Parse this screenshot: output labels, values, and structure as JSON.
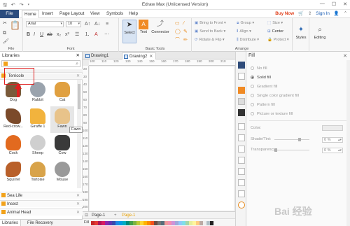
{
  "window": {
    "title": "Edraw Max (Unlicensed Version)",
    "controls": [
      "—",
      "☐",
      "✕"
    ]
  },
  "menu": {
    "file": "File",
    "items": [
      "Home",
      "Insert",
      "Page Layout",
      "View",
      "Symbols",
      "Help"
    ],
    "buy_now": "Buy Now",
    "sign_in": "Sign In"
  },
  "ribbon": {
    "font_name": "Arial",
    "font_size": "10",
    "group_file": "File",
    "group_font": "Font",
    "group_basic_tools": "Basic Tools",
    "group_arrange": "Arrange",
    "select": "Select",
    "text": "Text",
    "connector": "Connector",
    "bring_to_front": "Bring to Front",
    "send_to_back": "Send to Back",
    "rotate_flip": "Rotate & Flip",
    "group": "Group",
    "align": "Align",
    "distribute": "Distribute",
    "size": "Size",
    "center": "Center",
    "protect": "Protect",
    "styles": "Styles",
    "editing": "Editing"
  },
  "libraries": {
    "title": "Libraries",
    "category": "Terricole",
    "shapes": [
      {
        "label": "Dog",
        "color": "#7a5a3a"
      },
      {
        "label": "Rabbit",
        "color": "#9aa3ad"
      },
      {
        "label": "Cat",
        "color": "#e0a040"
      },
      {
        "label": "Red-crow...",
        "color": "#7b4a2a"
      },
      {
        "label": "Giraffe 1",
        "color": "#f2b33d"
      },
      {
        "label": "Fawn",
        "color": "#e8c38a"
      },
      {
        "label": "Cock",
        "color": "#e26a1f"
      },
      {
        "label": "Sheep",
        "color": "#cfcfcf"
      },
      {
        "label": "Cow",
        "color": "#3a3a3a"
      },
      {
        "label": "Squirrel",
        "color": "#b9602a"
      },
      {
        "label": "Tortoise",
        "color": "#d8a34a"
      },
      {
        "label": "Mouse",
        "color": "#9a9a9a"
      }
    ],
    "tooltip": "Fawn",
    "other_categories": [
      "Sea Life",
      "Insect",
      "Animal Head"
    ],
    "bottom_tabs": [
      "Libraries",
      "File Recovery"
    ]
  },
  "documents": {
    "tabs": [
      "Drawing1",
      "Drawing2"
    ],
    "ruler_h": [
      "100",
      "110",
      "120",
      "130",
      "140",
      "150",
      "160",
      "170",
      "180",
      "190",
      "200",
      "210"
    ],
    "ruler_v": [
      "20",
      "30",
      "40",
      "50",
      "60",
      "70",
      "80",
      "90",
      "100",
      "110",
      "120",
      "130",
      "140",
      "150",
      "160",
      "170",
      "180",
      "190",
      "200"
    ],
    "page_tabs": [
      "Page-1",
      "Page-1"
    ],
    "fill_label": "Fill"
  },
  "fill_panel": {
    "title": "Fill",
    "options": [
      "No fill",
      "Solid fill",
      "Gradient fill",
      "Single color gradient fill",
      "Pattern fill",
      "Picture or texture fill"
    ],
    "selected": "Solid fill",
    "color_label": "Color:",
    "shade_label": "Shade/Tint:",
    "shade_value": "0 %",
    "transparency_label": "Transparency:",
    "transparency_value": "0 %"
  },
  "watermark": "Bai 经验"
}
